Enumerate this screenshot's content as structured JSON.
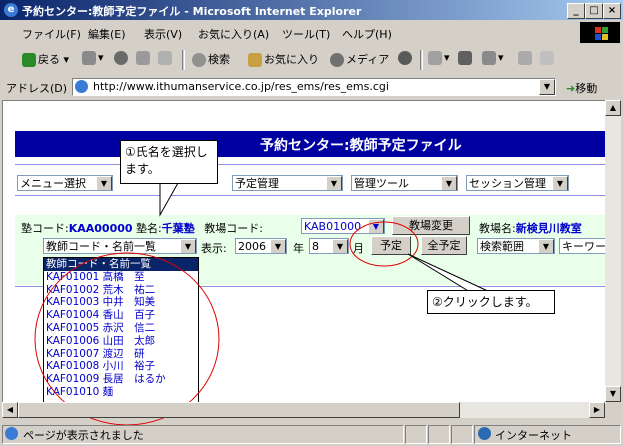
{
  "window": {
    "title": "予約センター:教師予定ファイル - Microsoft Internet Explorer"
  },
  "menubar": [
    "ファイル(F)",
    "編集(E)",
    "表示(V)",
    "お気に入り(A)",
    "ツール(T)",
    "ヘルプ(H)"
  ],
  "toolbar": {
    "back": "戻る",
    "search": "検索",
    "favorites": "お気に入り",
    "media": "メディア"
  },
  "address": {
    "label": "アドレス(D)",
    "url": "http://www.ithumanservice.co.jp/res_ems/res_ems.cgi",
    "go": "移動"
  },
  "page": {
    "header": "予約センター:教師予定ファイル",
    "nav": [
      "メニュー選択",
      "予定管理",
      "管理ツール",
      "セッション管理"
    ],
    "school_code_label": "塾コード:",
    "school_code": "KAA00000",
    "school_name_label": "塾名:",
    "school_name": "千葉塾",
    "venue_code_label": "教場コード:",
    "venue_code": "KAB01000",
    "venue_change": "教場変更",
    "venue_name_label": "教場名:",
    "venue_name": "新検見川教室",
    "teacher_select": "教師コード・名前一覧",
    "display_label": "表示:",
    "year": "2006",
    "year_label": "年",
    "month": "8",
    "month_label": "月",
    "btn_schedule": "予定",
    "btn_all_schedule": "全予定",
    "search_range": "検索範囲",
    "keyword": "キーワー",
    "teacher_list": [
      "教師コード・名前一覧",
      "KAF01001 高橋　至",
      "KAF01002 荒木　祐二",
      "KAF01003 中井　知美",
      "KAF01004 香山　百子",
      "KAF01005 赤沢　信二",
      "KAF01006 山田　太郎",
      "KAF01007 渡辺　研",
      "KAF01008 小川　裕子",
      "KAF01009 長居　はるか",
      "KAF01010 麺"
    ]
  },
  "callouts": {
    "one": "①氏名を選択します。",
    "two": "②クリックします。"
  },
  "status": {
    "text": "ページが表示されました",
    "zone": "インターネット"
  }
}
